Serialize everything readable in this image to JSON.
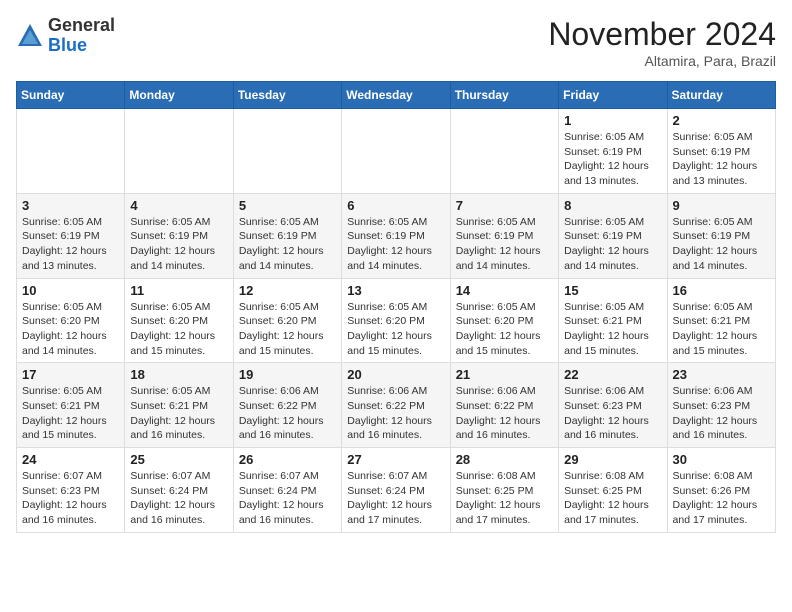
{
  "logo": {
    "general": "General",
    "blue": "Blue"
  },
  "header": {
    "month": "November 2024",
    "location": "Altamira, Para, Brazil"
  },
  "weekdays": [
    "Sunday",
    "Monday",
    "Tuesday",
    "Wednesday",
    "Thursday",
    "Friday",
    "Saturday"
  ],
  "weeks": [
    [
      {
        "date": "",
        "info": ""
      },
      {
        "date": "",
        "info": ""
      },
      {
        "date": "",
        "info": ""
      },
      {
        "date": "",
        "info": ""
      },
      {
        "date": "",
        "info": ""
      },
      {
        "date": "1",
        "info": "Sunrise: 6:05 AM\nSunset: 6:19 PM\nDaylight: 12 hours\nand 13 minutes."
      },
      {
        "date": "2",
        "info": "Sunrise: 6:05 AM\nSunset: 6:19 PM\nDaylight: 12 hours\nand 13 minutes."
      }
    ],
    [
      {
        "date": "3",
        "info": "Sunrise: 6:05 AM\nSunset: 6:19 PM\nDaylight: 12 hours\nand 13 minutes."
      },
      {
        "date": "4",
        "info": "Sunrise: 6:05 AM\nSunset: 6:19 PM\nDaylight: 12 hours\nand 14 minutes."
      },
      {
        "date": "5",
        "info": "Sunrise: 6:05 AM\nSunset: 6:19 PM\nDaylight: 12 hours\nand 14 minutes."
      },
      {
        "date": "6",
        "info": "Sunrise: 6:05 AM\nSunset: 6:19 PM\nDaylight: 12 hours\nand 14 minutes."
      },
      {
        "date": "7",
        "info": "Sunrise: 6:05 AM\nSunset: 6:19 PM\nDaylight: 12 hours\nand 14 minutes."
      },
      {
        "date": "8",
        "info": "Sunrise: 6:05 AM\nSunset: 6:19 PM\nDaylight: 12 hours\nand 14 minutes."
      },
      {
        "date": "9",
        "info": "Sunrise: 6:05 AM\nSunset: 6:19 PM\nDaylight: 12 hours\nand 14 minutes."
      }
    ],
    [
      {
        "date": "10",
        "info": "Sunrise: 6:05 AM\nSunset: 6:20 PM\nDaylight: 12 hours\nand 14 minutes."
      },
      {
        "date": "11",
        "info": "Sunrise: 6:05 AM\nSunset: 6:20 PM\nDaylight: 12 hours\nand 15 minutes."
      },
      {
        "date": "12",
        "info": "Sunrise: 6:05 AM\nSunset: 6:20 PM\nDaylight: 12 hours\nand 15 minutes."
      },
      {
        "date": "13",
        "info": "Sunrise: 6:05 AM\nSunset: 6:20 PM\nDaylight: 12 hours\nand 15 minutes."
      },
      {
        "date": "14",
        "info": "Sunrise: 6:05 AM\nSunset: 6:20 PM\nDaylight: 12 hours\nand 15 minutes."
      },
      {
        "date": "15",
        "info": "Sunrise: 6:05 AM\nSunset: 6:21 PM\nDaylight: 12 hours\nand 15 minutes."
      },
      {
        "date": "16",
        "info": "Sunrise: 6:05 AM\nSunset: 6:21 PM\nDaylight: 12 hours\nand 15 minutes."
      }
    ],
    [
      {
        "date": "17",
        "info": "Sunrise: 6:05 AM\nSunset: 6:21 PM\nDaylight: 12 hours\nand 15 minutes."
      },
      {
        "date": "18",
        "info": "Sunrise: 6:05 AM\nSunset: 6:21 PM\nDaylight: 12 hours\nand 16 minutes."
      },
      {
        "date": "19",
        "info": "Sunrise: 6:06 AM\nSunset: 6:22 PM\nDaylight: 12 hours\nand 16 minutes."
      },
      {
        "date": "20",
        "info": "Sunrise: 6:06 AM\nSunset: 6:22 PM\nDaylight: 12 hours\nand 16 minutes."
      },
      {
        "date": "21",
        "info": "Sunrise: 6:06 AM\nSunset: 6:22 PM\nDaylight: 12 hours\nand 16 minutes."
      },
      {
        "date": "22",
        "info": "Sunrise: 6:06 AM\nSunset: 6:23 PM\nDaylight: 12 hours\nand 16 minutes."
      },
      {
        "date": "23",
        "info": "Sunrise: 6:06 AM\nSunset: 6:23 PM\nDaylight: 12 hours\nand 16 minutes."
      }
    ],
    [
      {
        "date": "24",
        "info": "Sunrise: 6:07 AM\nSunset: 6:23 PM\nDaylight: 12 hours\nand 16 minutes."
      },
      {
        "date": "25",
        "info": "Sunrise: 6:07 AM\nSunset: 6:24 PM\nDaylight: 12 hours\nand 16 minutes."
      },
      {
        "date": "26",
        "info": "Sunrise: 6:07 AM\nSunset: 6:24 PM\nDaylight: 12 hours\nand 16 minutes."
      },
      {
        "date": "27",
        "info": "Sunrise: 6:07 AM\nSunset: 6:24 PM\nDaylight: 12 hours\nand 17 minutes."
      },
      {
        "date": "28",
        "info": "Sunrise: 6:08 AM\nSunset: 6:25 PM\nDaylight: 12 hours\nand 17 minutes."
      },
      {
        "date": "29",
        "info": "Sunrise: 6:08 AM\nSunset: 6:25 PM\nDaylight: 12 hours\nand 17 minutes."
      },
      {
        "date": "30",
        "info": "Sunrise: 6:08 AM\nSunset: 6:26 PM\nDaylight: 12 hours\nand 17 minutes."
      }
    ]
  ]
}
